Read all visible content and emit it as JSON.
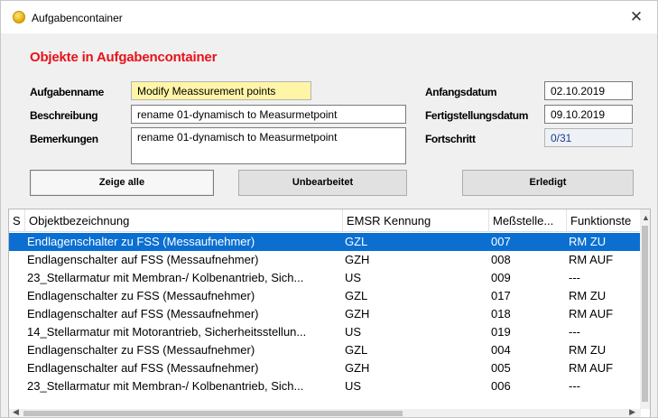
{
  "window": {
    "title": "Aufgabencontainer",
    "close_glyph": "✕",
    "icon": "app-coin-icon"
  },
  "section_title": "Objekte in Aufgabencontainer",
  "form": {
    "aufgabenname_label": "Aufgabenname",
    "aufgabenname_value": "Modify Meassurement points",
    "beschreibung_label": "Beschreibung",
    "beschreibung_value": "rename 01-dynamisch to Measurmetpoint",
    "bemerkungen_label": "Bemerkungen",
    "bemerkungen_value": "rename 01-dynamisch to Measurmetpoint",
    "anfangsdatum_label": "Anfangsdatum",
    "anfangsdatum_value": "02.10.2019",
    "fertigstellungsdatum_label": "Fertigstellungsdatum",
    "fertigstellungsdatum_value": "09.10.2019",
    "fortschritt_label": "Fortschritt",
    "fortschritt_value": "0/31"
  },
  "buttons": {
    "zeige_alle": "Zeige alle",
    "unbearbeitet": "Unbearbeitet",
    "erledigt": "Erledigt"
  },
  "table": {
    "columns": [
      "S",
      "Objektbezeichnung",
      "EMSR Kennung",
      "Meßstelle...",
      "Funktionste"
    ],
    "rows": [
      [
        "",
        "Endlagenschalter zu FSS (Messaufnehmer)",
        "GZL",
        "007",
        "RM ZU"
      ],
      [
        "",
        "Endlagenschalter auf FSS (Messaufnehmer)",
        "GZH",
        "008",
        "RM AUF"
      ],
      [
        "",
        "23_Stellarmatur mit Membran-/ Kolbenantrieb, Sich...",
        "US",
        "009",
        "---"
      ],
      [
        "",
        "Endlagenschalter zu FSS (Messaufnehmer)",
        "GZL",
        "017",
        "RM ZU"
      ],
      [
        "",
        "Endlagenschalter auf FSS (Messaufnehmer)",
        "GZH",
        "018",
        "RM AUF"
      ],
      [
        "",
        "14_Stellarmatur mit Motorantrieb, Sicherheitsstellun...",
        "US",
        "019",
        "---"
      ],
      [
        "",
        "Endlagenschalter zu FSS (Messaufnehmer)",
        "GZL",
        "004",
        "RM ZU"
      ],
      [
        "",
        "Endlagenschalter auf FSS (Messaufnehmer)",
        "GZH",
        "005",
        "RM AUF"
      ],
      [
        "",
        "23_Stellarmatur mit Membran-/ Kolbenantrieb, Sich...",
        "US",
        "006",
        "---"
      ]
    ],
    "selected_row": 0
  },
  "colors": {
    "title_red": "#e8121a",
    "selection_blue": "#0a6fd1",
    "field_yellow": "#fff5a6"
  }
}
